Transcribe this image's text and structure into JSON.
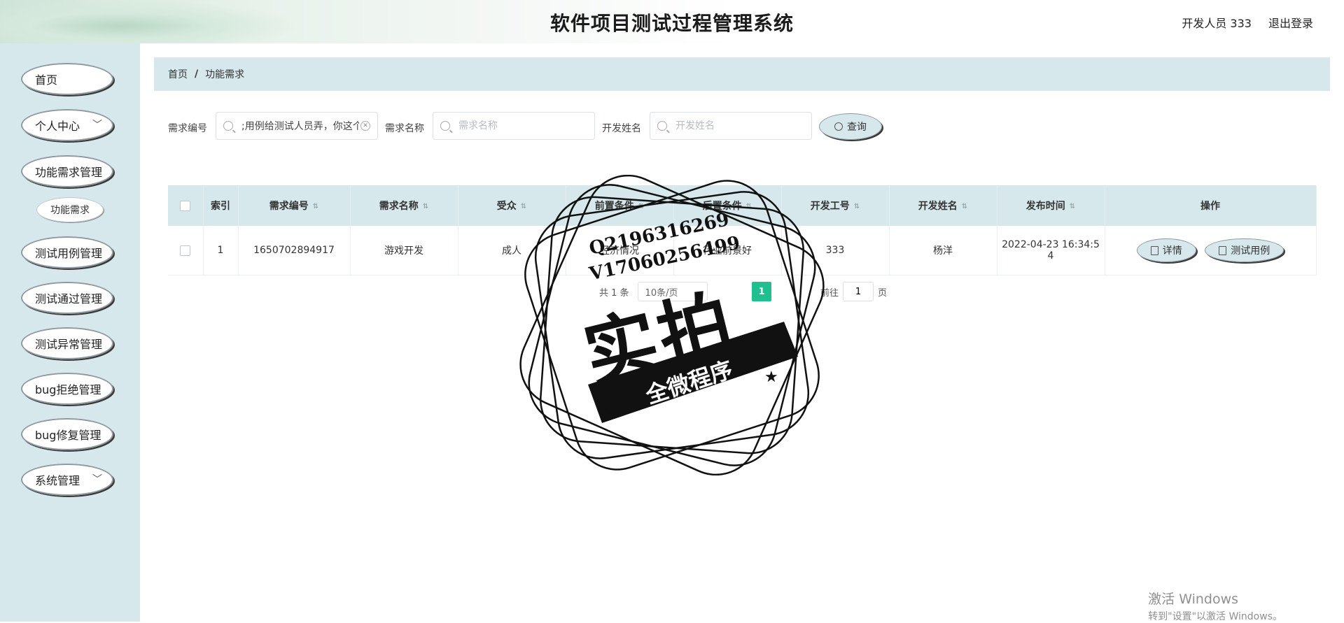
{
  "header": {
    "title": "软件项目测试过程管理系统",
    "user": "开发人员 333",
    "logout": "退出登录"
  },
  "sidebar": {
    "items": [
      {
        "label": "首页"
      },
      {
        "label": "个人中心"
      },
      {
        "label": "功能需求管理"
      },
      {
        "label": "功能需求"
      },
      {
        "label": "测试用例管理"
      },
      {
        "label": "测试通过管理"
      },
      {
        "label": "测试异常管理"
      },
      {
        "label": "bug拒绝管理"
      },
      {
        "label": "bug修复管理"
      },
      {
        "label": "系统管理"
      }
    ]
  },
  "breadcrumb": {
    "home": "首页",
    "sep": "/",
    "current": "功能需求"
  },
  "search": {
    "fields": [
      {
        "label": "需求编号",
        "value": ";用例给测试人员弄，你这个",
        "placeholder": "需求编号"
      },
      {
        "label": "需求名称",
        "value": "",
        "placeholder": "需求名称"
      },
      {
        "label": "开发姓名",
        "value": "",
        "placeholder": "开发姓名"
      }
    ],
    "button": "查询"
  },
  "table": {
    "columns": [
      "索引",
      "需求编号",
      "需求名称",
      "受众",
      "前置条件",
      "后置条件",
      "开发工号",
      "开发姓名",
      "发布时间",
      "操作"
    ],
    "rows": [
      {
        "index": "1",
        "code": "1650702894917",
        "name": "游戏开发",
        "audience": "成人",
        "pre": "经济情况",
        "post": "行业前景好",
        "dev_id": "333",
        "dev_name": "杨洋",
        "time_line1": "2022-04-23 16:34:5",
        "time_line2": "4"
      }
    ],
    "actions": {
      "detail": "详情",
      "testcase": "测试用例"
    }
  },
  "pagination": {
    "total": "共 1 条",
    "page_size": "10条/页",
    "current": "1",
    "jump_label": "前往",
    "jump_value": "1",
    "page_unit": "页"
  },
  "watermark": {
    "line1": "Q2196316269",
    "line2": "V17060256499",
    "big": "实拍",
    "band": "全微程序"
  },
  "windows": {
    "line1": "激活 Windows",
    "line2": "转到\"设置\"以激活 Windows。"
  }
}
